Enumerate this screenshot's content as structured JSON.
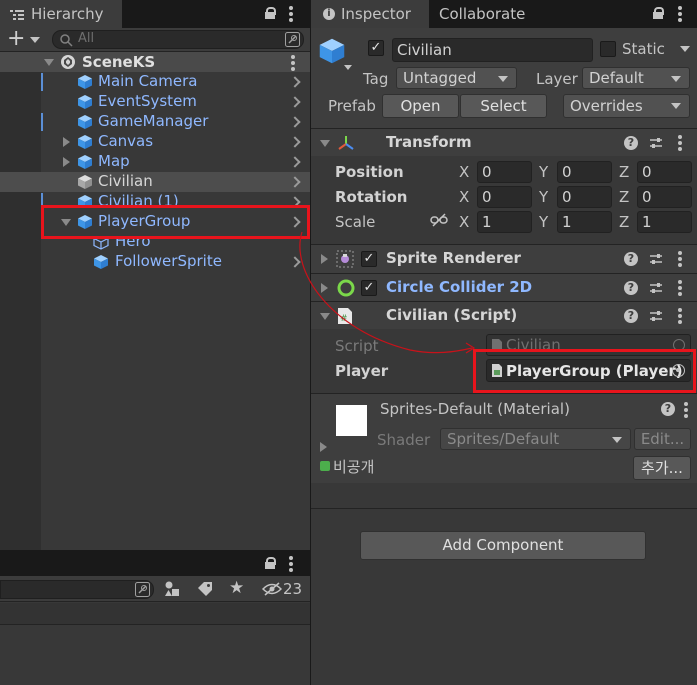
{
  "hierarchy": {
    "tab_label": "Hierarchy",
    "add_label": "+",
    "search_placeholder": "All",
    "scene_name": "SceneKS",
    "items": [
      {
        "label": "Main Camera"
      },
      {
        "label": "EventSystem"
      },
      {
        "label": "GameManager"
      },
      {
        "label": "Canvas"
      },
      {
        "label": "Map"
      },
      {
        "label": "Civilian"
      },
      {
        "label": "Civilian (1)"
      },
      {
        "label": "PlayerGroup"
      },
      {
        "label": "Hero"
      },
      {
        "label": "FollowerSprite"
      }
    ]
  },
  "project": {
    "hidden_count": "23"
  },
  "inspector": {
    "tabs": [
      {
        "label": "Inspector"
      },
      {
        "label": "Collaborate"
      }
    ],
    "object_name": "Civilian",
    "active_check": "✓",
    "static_label": "Static",
    "tag_label": "Tag",
    "tag_value": "Untagged",
    "layer_label": "Layer",
    "layer_value": "Default",
    "prefab_label": "Prefab",
    "open_label": "Open",
    "select_label": "Select",
    "overrides_label": "Overrides",
    "transform": {
      "title": "Transform",
      "position_label": "Position",
      "rotation_label": "Rotation",
      "scale_label": "Scale",
      "x_label": "X",
      "y_label": "Y",
      "z_label": "Z",
      "position": {
        "x": "0",
        "y": "0",
        "z": "0"
      },
      "rotation": {
        "x": "0",
        "y": "0",
        "z": "0"
      },
      "scale": {
        "x": "1",
        "y": "1",
        "z": "1"
      }
    },
    "sprite_renderer": {
      "title": "Sprite Renderer"
    },
    "circle_collider": {
      "title": "Circle Collider 2D"
    },
    "civilian_script": {
      "title": "Civilian (Script)",
      "script_label": "Script",
      "script_value": "Civilian",
      "player_label": "Player",
      "player_value": "PlayerGroup (Player)"
    },
    "material": {
      "title": "Sprites-Default (Material)",
      "shader_label": "Shader",
      "shader_value": "Sprites/Default",
      "edit_label": "Edit...",
      "korean_label": "비공개",
      "add_label": "추가..."
    },
    "add_component_label": "Add Component"
  },
  "colors": {
    "highlight_red": "#e8141c",
    "unity_blue": "#3a72b0",
    "prefab_blue": "#8fb8ff"
  }
}
